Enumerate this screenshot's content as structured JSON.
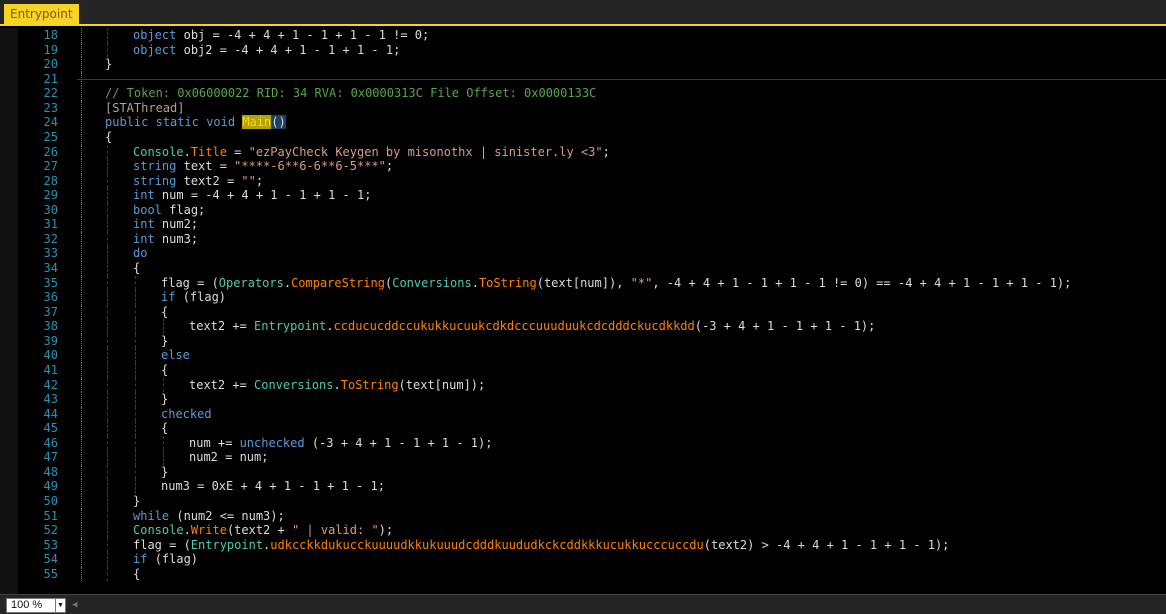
{
  "tab": {
    "title": "Entrypoint"
  },
  "statusbar": {
    "zoom": "100 %"
  },
  "colors": {
    "accent": "#f5d327",
    "keyword": "#569cd6",
    "string": "#d69d85",
    "comment": "#57a64a",
    "type": "#4ec9b0",
    "member": "#ff8000",
    "line_number": "#2b91af"
  },
  "code_lines": [
    {
      "n": "18",
      "tokens": [
        [
          "kw",
          "object"
        ],
        [
          "",
          "obj = -4 + 4 + 1 - 1 + 1 - 1 != 0;"
        ]
      ]
    },
    {
      "n": "19",
      "tokens": [
        [
          "kw",
          "object"
        ],
        [
          "",
          "obj2 = -4 + 4 + 1 - 1 + 1 - 1;"
        ]
      ]
    },
    {
      "n": "20",
      "tokens": [
        [
          "",
          "}"
        ]
      ]
    },
    {
      "n": "21",
      "tokens": []
    },
    {
      "n": "22",
      "tokens": [
        [
          "cm",
          "// Token: 0x06000022 RID: 34 RVA: 0x0000313C File Offset: 0x0000133C"
        ]
      ]
    },
    {
      "n": "23",
      "tokens": [
        [
          "attr",
          "[STAThread]"
        ]
      ]
    },
    {
      "n": "24",
      "tokens": [
        [
          "kw",
          "public"
        ],
        [
          "kw",
          "static"
        ],
        [
          "kw",
          "void"
        ],
        [
          "hl-name",
          "Main"
        ],
        [
          "hl-paren",
          "()"
        ]
      ]
    },
    {
      "n": "25",
      "tokens": [
        [
          "",
          "{"
        ]
      ]
    },
    {
      "n": "26",
      "tokens": [
        [
          "ty",
          "Console"
        ],
        [
          "",
          "."
        ],
        [
          "fn",
          "Title"
        ],
        [
          "",
          " = "
        ],
        [
          "str",
          "\"ezPayCheck Keygen by misonothx | sinister.ly <3\""
        ],
        [
          "",
          ";"
        ]
      ]
    },
    {
      "n": "27",
      "tokens": [
        [
          "kw",
          "string"
        ],
        [
          "",
          "text = "
        ],
        [
          "str",
          "\"****-6**6-6**6-5***\""
        ],
        [
          "",
          ";"
        ]
      ]
    },
    {
      "n": "28",
      "tokens": [
        [
          "kw",
          "string"
        ],
        [
          "",
          "text2 = "
        ],
        [
          "str",
          "\"\""
        ],
        [
          "",
          ";"
        ]
      ]
    },
    {
      "n": "29",
      "tokens": [
        [
          "kw",
          "int"
        ],
        [
          "",
          "num = -4 + 4 + 1 - 1 + 1 - 1;"
        ]
      ]
    },
    {
      "n": "30",
      "tokens": [
        [
          "kw",
          "bool"
        ],
        [
          "",
          "flag;"
        ]
      ]
    },
    {
      "n": "31",
      "tokens": [
        [
          "kw",
          "int"
        ],
        [
          "",
          "num2;"
        ]
      ]
    },
    {
      "n": "32",
      "tokens": [
        [
          "kw",
          "int"
        ],
        [
          "",
          "num3;"
        ]
      ]
    },
    {
      "n": "33",
      "tokens": [
        [
          "kw",
          "do"
        ]
      ]
    },
    {
      "n": "34",
      "tokens": [
        [
          "",
          "{"
        ]
      ]
    },
    {
      "n": "35",
      "tokens": [
        [
          "",
          "flag = ("
        ],
        [
          "ty",
          "Operators"
        ],
        [
          "",
          "."
        ],
        [
          "fn",
          "CompareString"
        ],
        [
          "",
          "("
        ],
        [
          "ty",
          "Conversions"
        ],
        [
          "",
          "."
        ],
        [
          "fn",
          "ToString"
        ],
        [
          "",
          "(text[num]), "
        ],
        [
          "str",
          "\"*\""
        ],
        [
          "",
          ", -4 + 4 + 1 - 1 + 1 - 1 != 0) == -4 + 4 + 1 - 1 + 1 - 1);"
        ]
      ]
    },
    {
      "n": "36",
      "tokens": [
        [
          "kw",
          "if"
        ],
        [
          "",
          "(flag)"
        ]
      ]
    },
    {
      "n": "37",
      "tokens": [
        [
          "",
          "{"
        ]
      ]
    },
    {
      "n": "38",
      "tokens": [
        [
          "",
          "text2 += "
        ],
        [
          "ty",
          "Entrypoint"
        ],
        [
          "",
          "."
        ],
        [
          "fn",
          "ccducucddccukukkucuukcdkdcccuuuduukcdcdddckucdkkdd"
        ],
        [
          "",
          "(-3 + 4 + 1 - 1 + 1 - 1);"
        ]
      ]
    },
    {
      "n": "39",
      "tokens": [
        [
          "",
          "}"
        ]
      ]
    },
    {
      "n": "40",
      "tokens": [
        [
          "kw",
          "else"
        ]
      ]
    },
    {
      "n": "41",
      "tokens": [
        [
          "",
          "{"
        ]
      ]
    },
    {
      "n": "42",
      "tokens": [
        [
          "",
          "text2 += "
        ],
        [
          "ty",
          "Conversions"
        ],
        [
          "",
          "."
        ],
        [
          "fn",
          "ToString"
        ],
        [
          "",
          "(text[num]);"
        ]
      ]
    },
    {
      "n": "43",
      "tokens": [
        [
          "",
          "}"
        ]
      ]
    },
    {
      "n": "44",
      "tokens": [
        [
          "kw",
          "checked"
        ]
      ]
    },
    {
      "n": "45",
      "tokens": [
        [
          "",
          "{"
        ]
      ]
    },
    {
      "n": "46",
      "tokens": [
        [
          "",
          "num += "
        ],
        [
          "kw",
          "unchecked"
        ],
        [
          "",
          "(-3 + 4 + 1 - 1 + 1 - 1);"
        ]
      ]
    },
    {
      "n": "47",
      "tokens": [
        [
          "",
          "num2 = num;"
        ]
      ]
    },
    {
      "n": "48",
      "tokens": [
        [
          "",
          "}"
        ]
      ]
    },
    {
      "n": "49",
      "tokens": [
        [
          "",
          "num3 = 0xE + 4 + 1 - 1 + 1 - 1;"
        ]
      ]
    },
    {
      "n": "50",
      "tokens": [
        [
          "",
          "}"
        ]
      ]
    },
    {
      "n": "51",
      "tokens": [
        [
          "kw",
          "while"
        ],
        [
          "",
          "(num2 <= num3);"
        ]
      ]
    },
    {
      "n": "52",
      "tokens": [
        [
          "ty",
          "Console"
        ],
        [
          "",
          "."
        ],
        [
          "fn",
          "Write"
        ],
        [
          "",
          "(text2 + "
        ],
        [
          "str",
          "\" | valid: \""
        ],
        [
          "",
          ");"
        ]
      ]
    },
    {
      "n": "53",
      "tokens": [
        [
          "",
          "flag = ("
        ],
        [
          "ty",
          "Entrypoint"
        ],
        [
          "",
          "."
        ],
        [
          "fn",
          "udkcckkdukucckuuuudkkukuuudcdddkuududkckcddkkkucukkucccuccdu"
        ],
        [
          "",
          "(text2) > -4 + 4 + 1 - 1 + 1 - 1);"
        ]
      ]
    },
    {
      "n": "54",
      "tokens": [
        [
          "kw",
          "if"
        ],
        [
          "",
          "(flag)"
        ]
      ]
    },
    {
      "n": "55",
      "tokens": [
        [
          "",
          "{"
        ]
      ]
    }
  ]
}
